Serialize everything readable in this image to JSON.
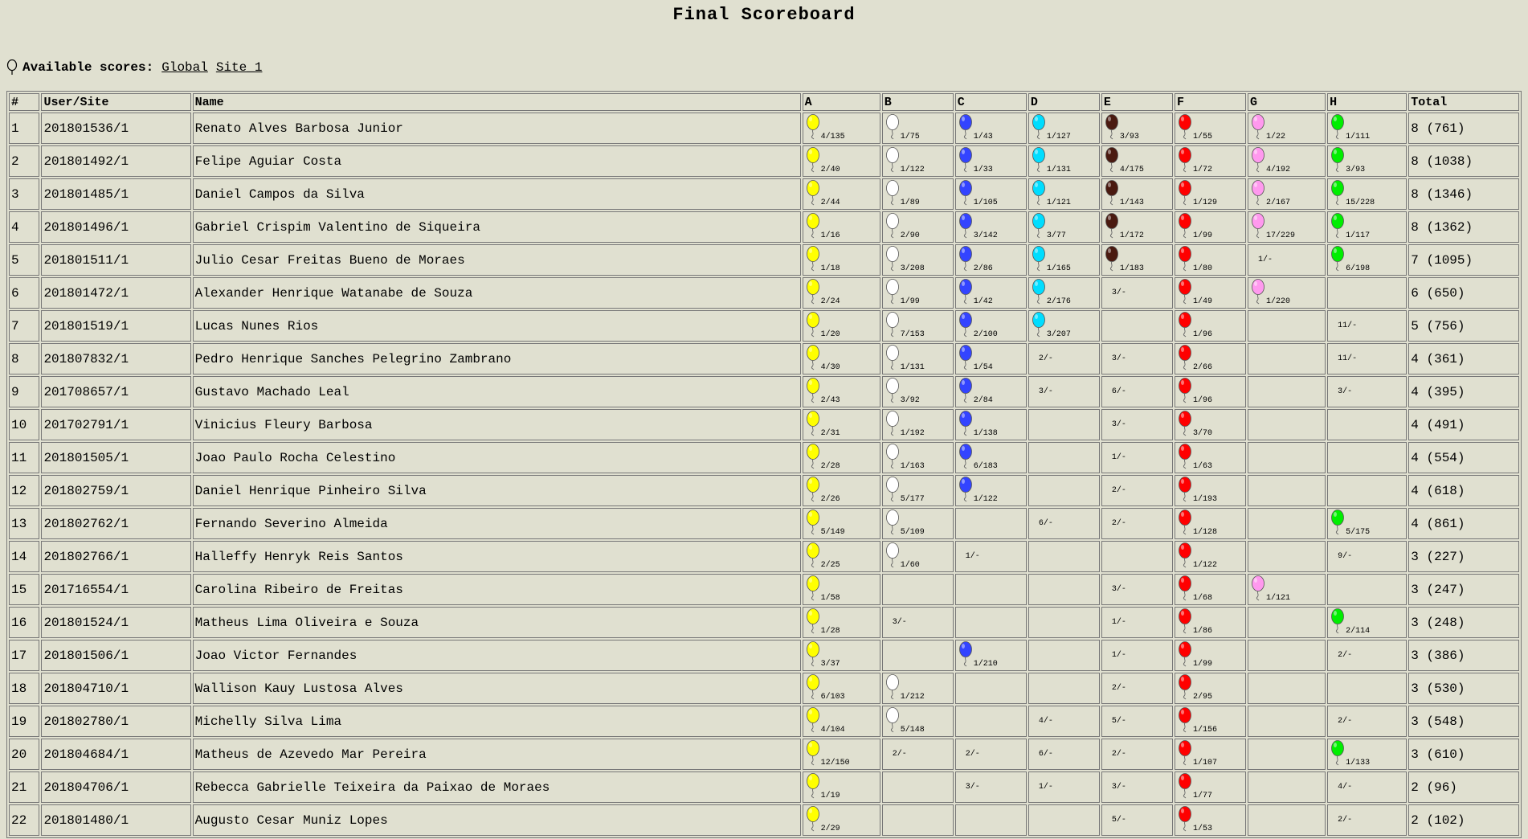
{
  "page": {
    "title": "Final Scoreboard"
  },
  "scores_bar": {
    "label": "Available scores:",
    "links": [
      "Global",
      "Site_1"
    ]
  },
  "table": {
    "headers": [
      "#",
      "User/Site",
      "Name",
      "A",
      "B",
      "C",
      "D",
      "E",
      "F",
      "G",
      "H",
      "Total"
    ],
    "problem_colors": {
      "A": "#ffff00",
      "B": "#ffffff",
      "C": "#3344ff",
      "D": "#00ddff",
      "E": "#4a1a10",
      "F": "#ff0000",
      "G": "#ff99ee",
      "H": "#00ee00"
    },
    "rows": [
      {
        "rank": "1",
        "user": "201801536/1",
        "name": "Renato Alves Barbosa Junior",
        "A": {
          "s": "4/135",
          "b": true
        },
        "B": {
          "s": "1/75",
          "b": true
        },
        "C": {
          "s": "1/43",
          "b": true
        },
        "D": {
          "s": "1/127",
          "b": true
        },
        "E": {
          "s": "3/93",
          "b": true
        },
        "F": {
          "s": "1/55",
          "b": true
        },
        "G": {
          "s": "1/22",
          "b": true
        },
        "H": {
          "s": "1/111",
          "b": true
        },
        "total": "8 (761)"
      },
      {
        "rank": "2",
        "user": "201801492/1",
        "name": "Felipe Aguiar Costa",
        "A": {
          "s": "2/40",
          "b": true
        },
        "B": {
          "s": "1/122",
          "b": true
        },
        "C": {
          "s": "1/33",
          "b": true
        },
        "D": {
          "s": "1/131",
          "b": true
        },
        "E": {
          "s": "4/175",
          "b": true
        },
        "F": {
          "s": "1/72",
          "b": true
        },
        "G": {
          "s": "4/192",
          "b": true
        },
        "H": {
          "s": "3/93",
          "b": true
        },
        "total": "8 (1038)"
      },
      {
        "rank": "3",
        "user": "201801485/1",
        "name": "Daniel Campos da Silva",
        "A": {
          "s": "2/44",
          "b": true
        },
        "B": {
          "s": "1/89",
          "b": true
        },
        "C": {
          "s": "1/105",
          "b": true
        },
        "D": {
          "s": "1/121",
          "b": true
        },
        "E": {
          "s": "1/143",
          "b": true
        },
        "F": {
          "s": "1/129",
          "b": true
        },
        "G": {
          "s": "2/167",
          "b": true
        },
        "H": {
          "s": "15/228",
          "b": true
        },
        "total": "8 (1346)"
      },
      {
        "rank": "4",
        "user": "201801496/1",
        "name": "Gabriel Crispim Valentino de Siqueira",
        "A": {
          "s": "1/16",
          "b": true
        },
        "B": {
          "s": "2/90",
          "b": true
        },
        "C": {
          "s": "3/142",
          "b": true
        },
        "D": {
          "s": "3/77",
          "b": true
        },
        "E": {
          "s": "1/172",
          "b": true
        },
        "F": {
          "s": "1/99",
          "b": true
        },
        "G": {
          "s": "17/229",
          "b": true
        },
        "H": {
          "s": "1/117",
          "b": true
        },
        "total": "8 (1362)"
      },
      {
        "rank": "5",
        "user": "201801511/1",
        "name": "Julio Cesar Freitas Bueno de Moraes",
        "A": {
          "s": "1/18",
          "b": true
        },
        "B": {
          "s": "3/208",
          "b": true
        },
        "C": {
          "s": "2/86",
          "b": true
        },
        "D": {
          "s": "1/165",
          "b": true
        },
        "E": {
          "s": "1/183",
          "b": true
        },
        "F": {
          "s": "1/80",
          "b": true
        },
        "G": {
          "s": "1/-",
          "b": false
        },
        "H": {
          "s": "6/198",
          "b": true
        },
        "total": "7 (1095)"
      },
      {
        "rank": "6",
        "user": "201801472/1",
        "name": "Alexander Henrique Watanabe de Souza",
        "A": {
          "s": "2/24",
          "b": true
        },
        "B": {
          "s": "1/99",
          "b": true
        },
        "C": {
          "s": "1/42",
          "b": true
        },
        "D": {
          "s": "2/176",
          "b": true
        },
        "E": {
          "s": "3/-",
          "b": false
        },
        "F": {
          "s": "1/49",
          "b": true
        },
        "G": {
          "s": "1/220",
          "b": true
        },
        "H": null,
        "total": "6 (650)"
      },
      {
        "rank": "7",
        "user": "201801519/1",
        "name": "Lucas Nunes Rios",
        "A": {
          "s": "1/20",
          "b": true
        },
        "B": {
          "s": "7/153",
          "b": true
        },
        "C": {
          "s": "2/100",
          "b": true
        },
        "D": {
          "s": "3/207",
          "b": true
        },
        "E": null,
        "F": {
          "s": "1/96",
          "b": true
        },
        "G": null,
        "H": {
          "s": "11/-",
          "b": false
        },
        "total": "5 (756)"
      },
      {
        "rank": "8",
        "user": "201807832/1",
        "name": "Pedro Henrique Sanches Pelegrino Zambrano",
        "A": {
          "s": "4/30",
          "b": true
        },
        "B": {
          "s": "1/131",
          "b": true
        },
        "C": {
          "s": "1/54",
          "b": true
        },
        "D": {
          "s": "2/-",
          "b": false
        },
        "E": {
          "s": "3/-",
          "b": false
        },
        "F": {
          "s": "2/66",
          "b": true
        },
        "G": null,
        "H": {
          "s": "11/-",
          "b": false
        },
        "total": "4 (361)"
      },
      {
        "rank": "9",
        "user": "201708657/1",
        "name": "Gustavo Machado Leal",
        "A": {
          "s": "2/43",
          "b": true
        },
        "B": {
          "s": "3/92",
          "b": true
        },
        "C": {
          "s": "2/84",
          "b": true
        },
        "D": {
          "s": "3/-",
          "b": false
        },
        "E": {
          "s": "6/-",
          "b": false
        },
        "F": {
          "s": "1/96",
          "b": true
        },
        "G": null,
        "H": {
          "s": "3/-",
          "b": false
        },
        "total": "4 (395)"
      },
      {
        "rank": "10",
        "user": "201702791/1",
        "name": "Vinicius Fleury Barbosa",
        "A": {
          "s": "2/31",
          "b": true
        },
        "B": {
          "s": "1/192",
          "b": true
        },
        "C": {
          "s": "1/138",
          "b": true
        },
        "D": null,
        "E": {
          "s": "3/-",
          "b": false
        },
        "F": {
          "s": "3/70",
          "b": true
        },
        "G": null,
        "H": null,
        "total": "4 (491)"
      },
      {
        "rank": "11",
        "user": "201801505/1",
        "name": "Joao Paulo Rocha Celestino",
        "A": {
          "s": "2/28",
          "b": true
        },
        "B": {
          "s": "1/163",
          "b": true
        },
        "C": {
          "s": "6/183",
          "b": true
        },
        "D": null,
        "E": {
          "s": "1/-",
          "b": false
        },
        "F": {
          "s": "1/63",
          "b": true
        },
        "G": null,
        "H": null,
        "total": "4 (554)"
      },
      {
        "rank": "12",
        "user": "201802759/1",
        "name": "Daniel Henrique Pinheiro Silva",
        "A": {
          "s": "2/26",
          "b": true
        },
        "B": {
          "s": "5/177",
          "b": true
        },
        "C": {
          "s": "1/122",
          "b": true
        },
        "D": null,
        "E": {
          "s": "2/-",
          "b": false
        },
        "F": {
          "s": "1/193",
          "b": true
        },
        "G": null,
        "H": null,
        "total": "4 (618)"
      },
      {
        "rank": "13",
        "user": "201802762/1",
        "name": "Fernando Severino Almeida",
        "A": {
          "s": "5/149",
          "b": true
        },
        "B": {
          "s": "5/109",
          "b": true
        },
        "C": null,
        "D": {
          "s": "6/-",
          "b": false
        },
        "E": {
          "s": "2/-",
          "b": false
        },
        "F": {
          "s": "1/128",
          "b": true
        },
        "G": null,
        "H": {
          "s": "5/175",
          "b": true
        },
        "total": "4 (861)"
      },
      {
        "rank": "14",
        "user": "201802766/1",
        "name": "Halleffy Henryk Reis Santos",
        "A": {
          "s": "2/25",
          "b": true
        },
        "B": {
          "s": "1/60",
          "b": true
        },
        "C": {
          "s": "1/-",
          "b": false
        },
        "D": null,
        "E": null,
        "F": {
          "s": "1/122",
          "b": true
        },
        "G": null,
        "H": {
          "s": "9/-",
          "b": false
        },
        "total": "3 (227)"
      },
      {
        "rank": "15",
        "user": "201716554/1",
        "name": "Carolina Ribeiro de Freitas",
        "A": {
          "s": "1/58",
          "b": true
        },
        "B": null,
        "C": null,
        "D": null,
        "E": {
          "s": "3/-",
          "b": false
        },
        "F": {
          "s": "1/68",
          "b": true
        },
        "G": {
          "s": "1/121",
          "b": true
        },
        "H": null,
        "total": "3 (247)"
      },
      {
        "rank": "16",
        "user": "201801524/1",
        "name": "Matheus Lima Oliveira e Souza",
        "A": {
          "s": "1/28",
          "b": true
        },
        "B": {
          "s": "3/-",
          "b": false
        },
        "C": null,
        "D": null,
        "E": {
          "s": "1/-",
          "b": false
        },
        "F": {
          "s": "1/86",
          "b": true
        },
        "G": null,
        "H": {
          "s": "2/114",
          "b": true
        },
        "total": "3 (248)"
      },
      {
        "rank": "17",
        "user": "201801506/1",
        "name": "Joao Victor Fernandes",
        "A": {
          "s": "3/37",
          "b": true
        },
        "B": null,
        "C": {
          "s": "1/210",
          "b": true
        },
        "D": null,
        "E": {
          "s": "1/-",
          "b": false
        },
        "F": {
          "s": "1/99",
          "b": true
        },
        "G": null,
        "H": {
          "s": "2/-",
          "b": false
        },
        "total": "3 (386)"
      },
      {
        "rank": "18",
        "user": "201804710/1",
        "name": "Wallison Kauy Lustosa Alves",
        "A": {
          "s": "6/103",
          "b": true
        },
        "B": {
          "s": "1/212",
          "b": true
        },
        "C": null,
        "D": null,
        "E": {
          "s": "2/-",
          "b": false
        },
        "F": {
          "s": "2/95",
          "b": true
        },
        "G": null,
        "H": null,
        "total": "3 (530)"
      },
      {
        "rank": "19",
        "user": "201802780/1",
        "name": "Michelly Silva Lima",
        "A": {
          "s": "4/104",
          "b": true
        },
        "B": {
          "s": "5/148",
          "b": true
        },
        "C": null,
        "D": {
          "s": "4/-",
          "b": false
        },
        "E": {
          "s": "5/-",
          "b": false
        },
        "F": {
          "s": "1/156",
          "b": true
        },
        "G": null,
        "H": {
          "s": "2/-",
          "b": false
        },
        "total": "3 (548)"
      },
      {
        "rank": "20",
        "user": "201804684/1",
        "name": "Matheus de Azevedo Mar Pereira",
        "A": {
          "s": "12/150",
          "b": true
        },
        "B": {
          "s": "2/-",
          "b": false
        },
        "C": {
          "s": "2/-",
          "b": false
        },
        "D": {
          "s": "6/-",
          "b": false
        },
        "E": {
          "s": "2/-",
          "b": false
        },
        "F": {
          "s": "1/107",
          "b": true
        },
        "G": null,
        "H": {
          "s": "1/133",
          "b": true
        },
        "total": "3 (610)"
      },
      {
        "rank": "21",
        "user": "201804706/1",
        "name": "Rebecca Gabrielle Teixeira da Paixao de Moraes",
        "A": {
          "s": "1/19",
          "b": true
        },
        "B": null,
        "C": {
          "s": "3/-",
          "b": false
        },
        "D": {
          "s": "1/-",
          "b": false
        },
        "E": {
          "s": "3/-",
          "b": false
        },
        "F": {
          "s": "1/77",
          "b": true
        },
        "G": null,
        "H": {
          "s": "4/-",
          "b": false
        },
        "total": "2 (96)"
      },
      {
        "rank": "22",
        "user": "201801480/1",
        "name": "Augusto Cesar Muniz Lopes",
        "A": {
          "s": "2/29",
          "b": true
        },
        "B": null,
        "C": null,
        "D": null,
        "E": {
          "s": "5/-",
          "b": false
        },
        "F": {
          "s": "1/53",
          "b": true
        },
        "G": null,
        "H": {
          "s": "2/-",
          "b": false
        },
        "total": "2 (102)"
      }
    ]
  }
}
